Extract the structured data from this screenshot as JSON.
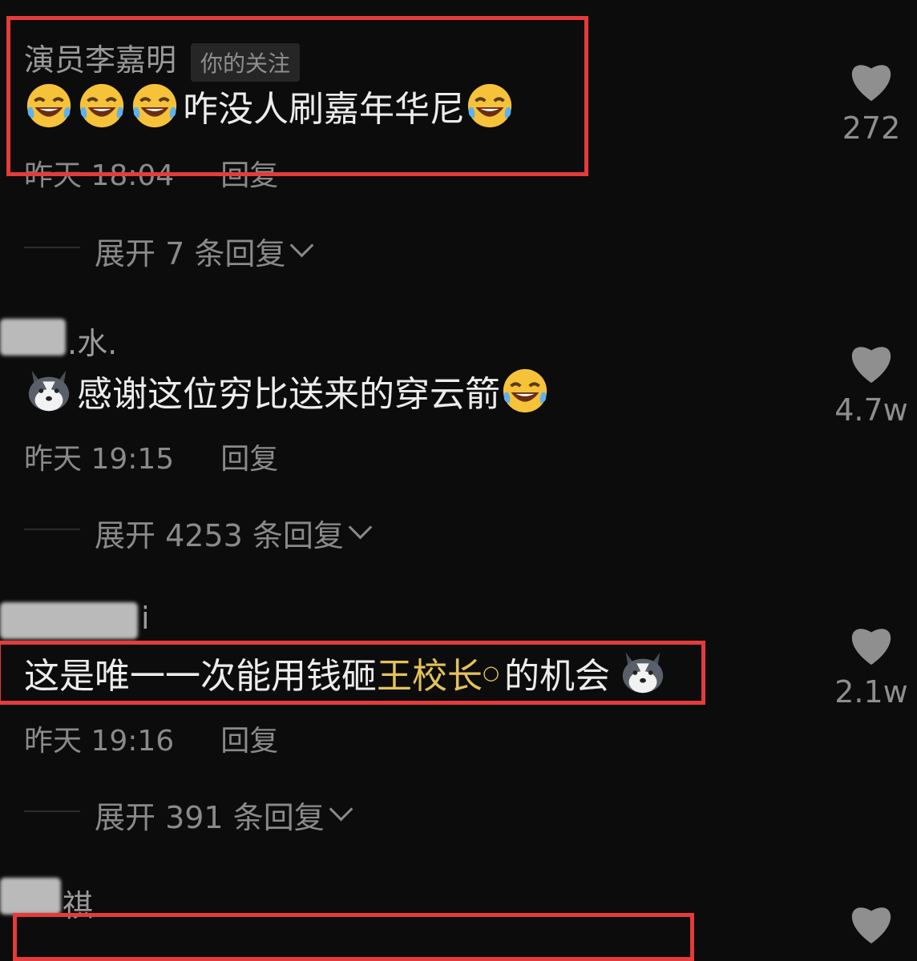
{
  "comments": [
    {
      "username": "演员李嘉明",
      "badge": "你的关注",
      "text": "咋没人刷嘉年华尼",
      "time": "昨天 18:04",
      "reply": "回复",
      "expand": "展开 7 条回复",
      "likes": "272"
    },
    {
      "username": ".水.",
      "text": "感谢这位穷比送来的穿云箭",
      "time": "昨天 19:15",
      "reply": "回复",
      "expand": "展开 4253 条回复",
      "likes": "4.7w"
    },
    {
      "username": "i",
      "text_before": "这是唯一一次能用钱砸",
      "text_link": "王校长",
      "text_after": "的机会",
      "time": "昨天 19:16",
      "reply": "回复",
      "expand": "展开 391 条回复",
      "likes": "2.1w"
    },
    {
      "username": "祺"
    }
  ],
  "colors": {
    "background": "#0c0c0c",
    "highlight_box": "#e53b3b",
    "keyword_link": "#e4c25a"
  },
  "icons": [
    "heart-icon",
    "rofl-emoji-icon",
    "husky-emoji-icon",
    "chevron-down-icon",
    "search-icon"
  ]
}
